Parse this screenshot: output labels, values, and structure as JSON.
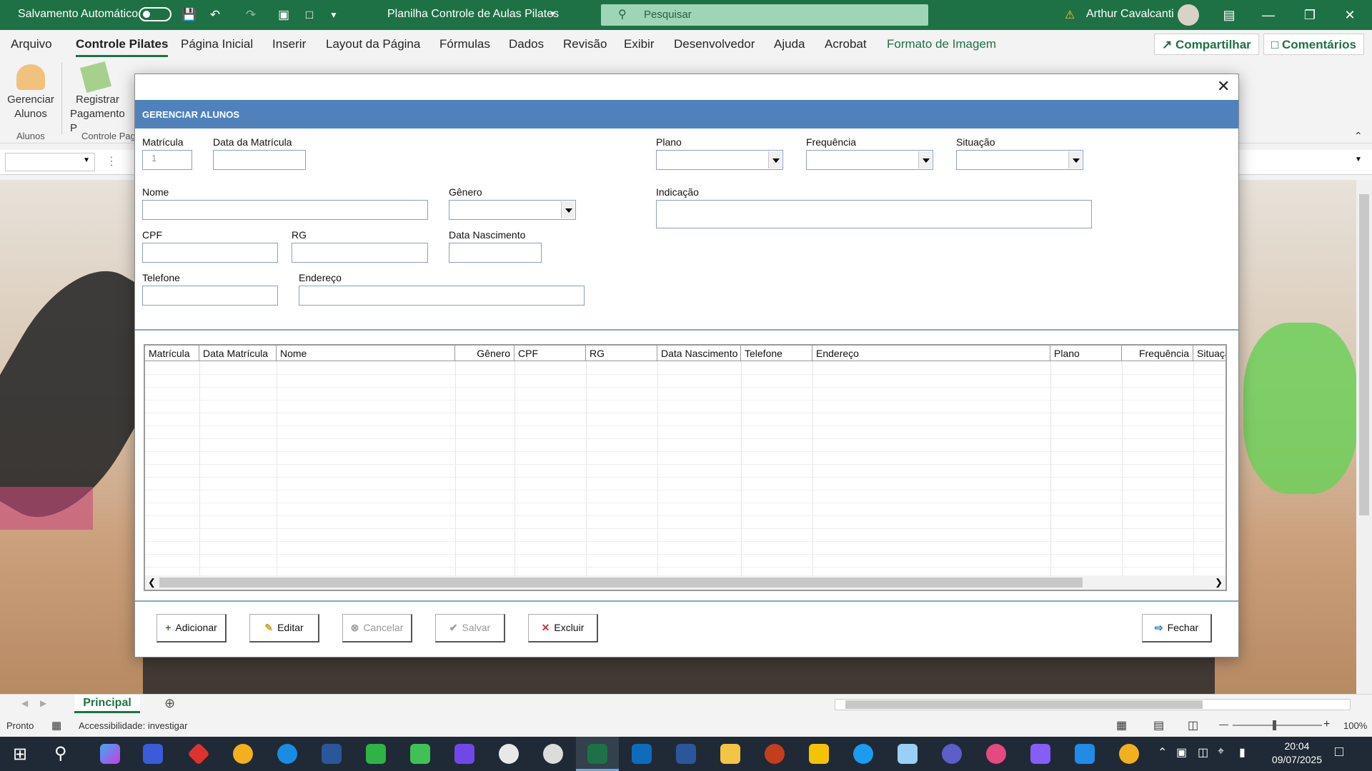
{
  "titlebar": {
    "autosave_label": "Salvamento Automático",
    "doc_title": "Planilha Controle de Aulas Pilates",
    "search_placeholder": "Pesquisar",
    "user_name": "Arthur Cavalcanti"
  },
  "ribbon_tabs": [
    "Arquivo",
    "Controle Pilates",
    "Página Inicial",
    "Inserir",
    "Layout da Página",
    "Fórmulas",
    "Dados",
    "Revisão",
    "Exibir",
    "Desenvolvedor",
    "Ajuda",
    "Acrobat",
    "Formato de Imagem"
  ],
  "share_label": "Compartilhar",
  "comments_label": "Comentários",
  "ribbon": {
    "gerenciar_label_1": "Gerenciar",
    "gerenciar_label_2": "Alunos",
    "registrar_label_1": "Registrar",
    "registrar_label_2": "Pagamento P",
    "group_alunos": "Alunos",
    "group_controle": "Controle Pag"
  },
  "dialog": {
    "header": "GERENCIAR ALUNOS",
    "labels": {
      "matricula": "Matrícula",
      "data_matricula": "Data da Matrícula",
      "plano": "Plano",
      "frequencia": "Frequência",
      "situacao": "Situação",
      "nome": "Nome",
      "genero": "Gênero",
      "indicacao": "Indicação",
      "cpf": "CPF",
      "rg": "RG",
      "data_nascimento": "Data Nascimento",
      "telefone": "Telefone",
      "endereco": "Endereço"
    },
    "values": {
      "matricula": "1"
    },
    "columns": [
      "Matrícula",
      "Data Matrícula",
      "Nome",
      "Gênero",
      "CPF",
      "RG",
      "Data Nascimento",
      "Telefone",
      "Endereço",
      "Plano",
      "Frequência",
      "Situaçã"
    ],
    "buttons": {
      "adicionar": "Adicionar",
      "editar": "Editar",
      "cancelar": "Cancelar",
      "salvar": "Salvar",
      "excluir": "Excluir",
      "fechar": "Fechar"
    }
  },
  "sheet_tab": "Principal",
  "status": {
    "ready": "Pronto",
    "accessibility": "Accessibilidade: investigar",
    "zoom": "100%"
  },
  "clock": {
    "time": "20:04",
    "date": "09/07/2025"
  }
}
